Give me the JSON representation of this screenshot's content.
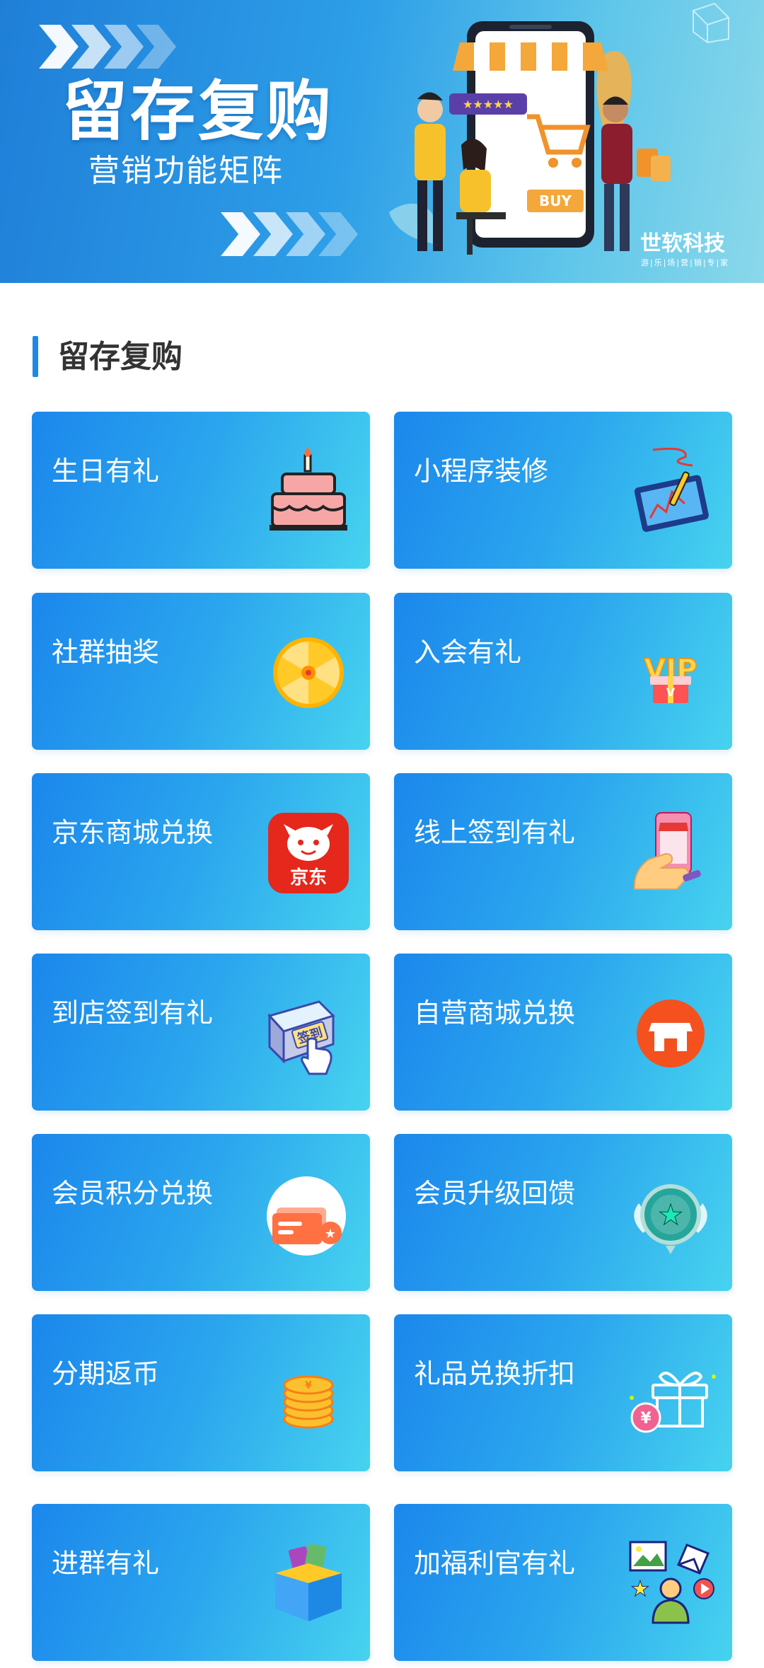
{
  "banner": {
    "title": "留存复购",
    "subtitle": "营销功能矩阵",
    "brand_name": "世软科技",
    "brand_tagline": "游|乐|场|营|销|专|家",
    "illustration_buy_label": "BUY"
  },
  "section": {
    "title": "留存复购"
  },
  "cards": [
    {
      "label": "生日有礼",
      "icon": "birthday-cake-icon"
    },
    {
      "label": "小程序装修",
      "icon": "tablet-pen-icon"
    },
    {
      "label": "社群抽奖",
      "icon": "lottery-wheel-icon"
    },
    {
      "label": "入会有礼",
      "icon": "vip-gift-icon"
    },
    {
      "label": "京东商城兑换",
      "icon": "jd-logo-icon",
      "icon_text": "京东"
    },
    {
      "label": "线上签到有礼",
      "icon": "phone-checkin-icon"
    },
    {
      "label": "到店签到有礼",
      "icon": "checkin-button-icon",
      "icon_text": "签到"
    },
    {
      "label": "自营商城兑换",
      "icon": "store-icon"
    },
    {
      "label": "会员积分兑换",
      "icon": "points-card-icon"
    },
    {
      "label": "会员升级回馈",
      "icon": "star-badge-icon"
    },
    {
      "label": "分期返币",
      "icon": "coin-stack-icon"
    },
    {
      "label": "礼品兑换折扣",
      "icon": "gift-yuan-icon",
      "icon_text": "¥"
    },
    {
      "label": "进群有礼",
      "icon": "gift-box-icon"
    },
    {
      "label": "加福利官有礼",
      "icon": "welfare-officer-icon"
    }
  ],
  "colors": {
    "accent": "#1e88e5",
    "card_gradient_start": "#1b87ec",
    "card_gradient_end": "#47d3ef",
    "title_text": "#333333"
  }
}
